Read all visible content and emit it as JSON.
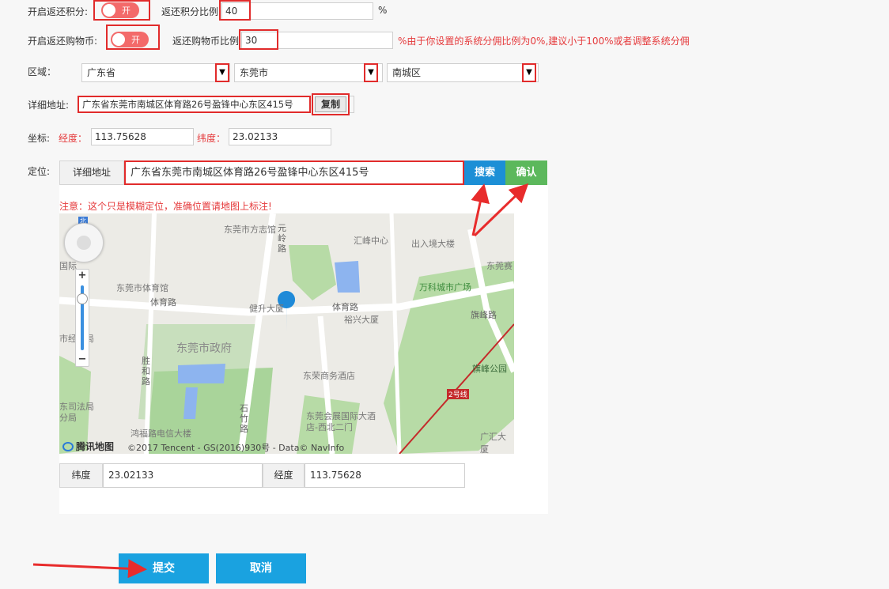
{
  "points": {
    "enable_label": "开启返还积分:",
    "toggle_text": "开",
    "ratio_label": "返还积分比例",
    "ratio_value": "40",
    "percent": "%"
  },
  "coins": {
    "enable_label": "开启返还购物币:",
    "toggle_text": "开",
    "ratio_label": "返还购物币比例",
    "ratio_value": "30",
    "warning": "%由于你设置的系统分佣比例为0%,建议小于100%或者调整系统分佣"
  },
  "region": {
    "label": "区域：",
    "province": "广东省",
    "city": "东莞市",
    "district": "南城区",
    "arrow": "▼"
  },
  "address": {
    "label": "详细地址:",
    "value": "广东省东莞市南城区体育路26号盈锋中心东区415号",
    "copy_button": "复制"
  },
  "coords": {
    "label": "坐标:",
    "lng_label": "经度：",
    "lng_value": "113.75628",
    "lat_label": "纬度：",
    "lat_value": "23.02133"
  },
  "locate": {
    "label": "定位:",
    "addon": "详细地址",
    "value": "广东省东莞市南城区体育路26号盈锋中心东区415号",
    "search_button": "搜索",
    "confirm_button": "确认",
    "notice": "注意：这个只是模糊定位，准确位置请地图上标注!"
  },
  "map": {
    "compass_label": "北",
    "places": [
      "东莞市方志馆",
      "汇峰中心",
      "出入境大楼",
      "东莞赛",
      "万科城市广场",
      "东莞市体育馆",
      "体育路",
      "健升大厦",
      "体育路",
      "裕兴大厦",
      "旗峰路",
      "东莞市政府",
      "旗峰公园",
      "东荣商务酒店",
      "胜和路",
      "东莞会展国际大酒店-西北二门",
      "石竹路",
      "鸿福路电信大楼",
      "广汇大厦",
      "元岭路",
      "2号线",
      "东司法局",
      "分局",
      "市经贸局",
      "国际"
    ],
    "logo_text": "腾讯地图",
    "copyright": "©2017 Tencent - GS(2016)930号 - Data© NavInfo",
    "zoom_in": "+",
    "zoom_out": "−"
  },
  "result": {
    "lat_label": "纬度",
    "lat_value": "23.02133",
    "lng_label": "经度",
    "lng_value": "113.75628"
  },
  "actions": {
    "submit": "提交",
    "cancel": "取消"
  },
  "colors": {
    "toggle_on": "#f36a6a",
    "highlight": "#e12b2b",
    "search_btn": "#1c8fd6",
    "confirm_btn": "#5cb85c",
    "action_btn": "#1aa2e0"
  }
}
